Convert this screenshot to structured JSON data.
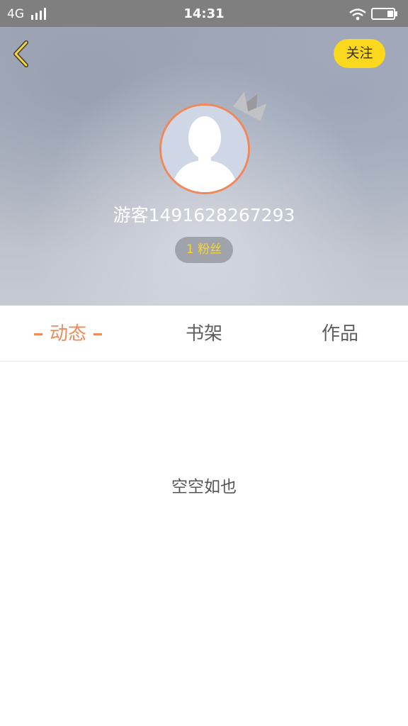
{
  "status_bar": {
    "network": "4G",
    "time": "14:31"
  },
  "header": {
    "follow_label": "关注",
    "username": "游客1491628267293",
    "fans": "1 粉丝"
  },
  "tabs": [
    {
      "label": "动态",
      "active": true
    },
    {
      "label": "书架",
      "active": false
    },
    {
      "label": "作品",
      "active": false
    }
  ],
  "content": {
    "empty_text": "空空如也"
  },
  "colors": {
    "accent": "#f08a5a",
    "follow_button": "#f9d81e",
    "fans_text": "#f6d72a"
  }
}
